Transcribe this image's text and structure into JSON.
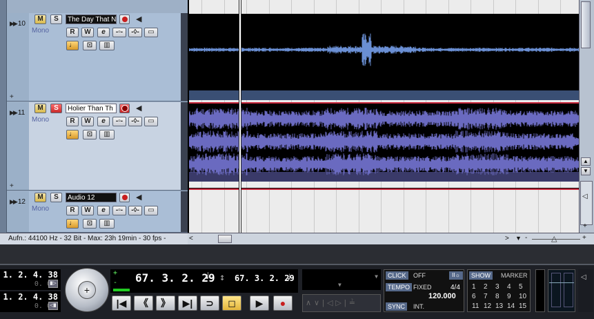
{
  "tracks": [
    {
      "num": "10",
      "name": "The Day That N",
      "mode": "Mono",
      "selected": false,
      "solo_on": false,
      "rec_on": false
    },
    {
      "num": "11",
      "name": "Holier Than Th",
      "mode": "Mono",
      "selected": true,
      "solo_on": true,
      "rec_on": true
    },
    {
      "num": "12",
      "name": "Audio 12",
      "mode": "Mono",
      "selected": false,
      "solo_on": false,
      "rec_on": false
    }
  ],
  "labels": {
    "mute": "M",
    "solo": "S",
    "read": "R",
    "write": "W",
    "edit": "e",
    "plus": "+"
  },
  "status": {
    "text": "Aufn.: 44100 Hz - 32 Bit - Max: 23h 19min - 30 fps -"
  },
  "transport": {
    "left_locator": "1. 2. 4. 38",
    "left_sub": "0.   0",
    "right_locator": "1. 2. 4. 38",
    "right_sub": "0.   0",
    "main_position": "67. 3. 2. 29",
    "sec_position": "67. 3. 2. 29",
    "click_label": "CLICK",
    "click_value": "OFF",
    "tempo_label": "TEMPO",
    "tempo_mode": "FIXED",
    "signature": "4/4",
    "tempo_value": "120.000",
    "sync_label": "SYNC",
    "sync_value": "INT.",
    "show_label": "SHOW",
    "marker_label": "MARKER",
    "markers_row1": [
      "1",
      "2",
      "3",
      "4",
      "5"
    ],
    "markers_row2": [
      "6",
      "7",
      "8",
      "9",
      "10"
    ],
    "markers_row3": [
      "11",
      "12",
      "13",
      "14",
      "15"
    ]
  },
  "colors": {
    "wave_blue": "#6a8fd4",
    "wave_purple": "#6a6ac0",
    "accent_red": "#c81e1e"
  }
}
